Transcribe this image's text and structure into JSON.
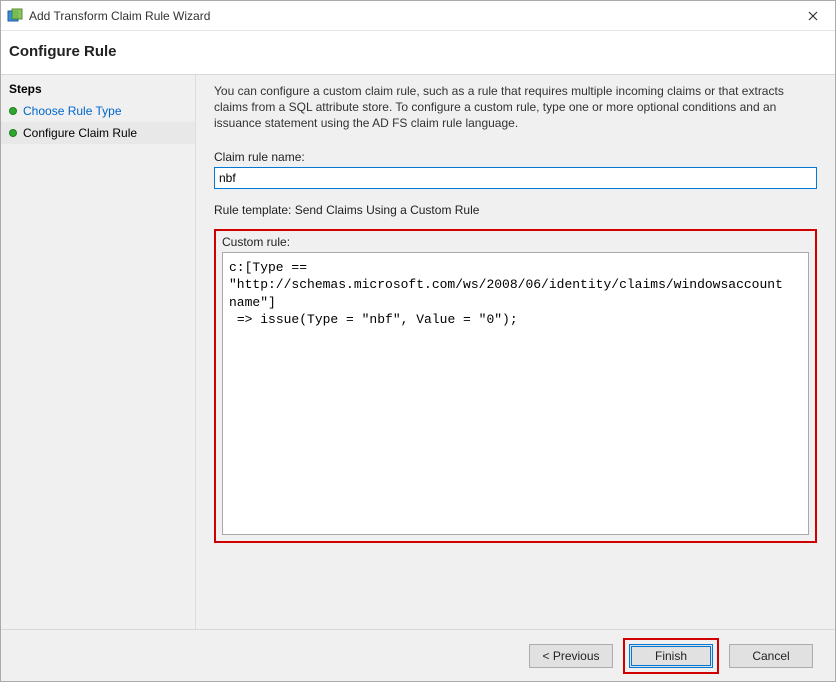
{
  "window": {
    "title": "Add Transform Claim Rule Wizard"
  },
  "header": {
    "title": "Configure Rule"
  },
  "sidebar": {
    "heading": "Steps",
    "items": [
      {
        "label": "Choose Rule Type",
        "link": true,
        "current": false
      },
      {
        "label": "Configure Claim Rule",
        "link": false,
        "current": true
      }
    ]
  },
  "main": {
    "description": "You can configure a custom claim rule, such as a rule that requires multiple incoming claims or that extracts claims from a SQL attribute store. To configure a custom rule, type one or more optional conditions and an issuance statement using the AD FS claim rule language.",
    "rule_name_label": "Claim rule name:",
    "rule_name_value": "nbf",
    "template_line": "Rule template: Send Claims Using a Custom Rule",
    "custom_rule_label": "Custom rule:",
    "custom_rule_value": "c:[Type == \"http://schemas.microsoft.com/ws/2008/06/identity/claims/windowsaccountname\"]\n => issue(Type = \"nbf\", Value = \"0\");"
  },
  "buttons": {
    "previous": "< Previous",
    "finish": "Finish",
    "cancel": "Cancel"
  }
}
